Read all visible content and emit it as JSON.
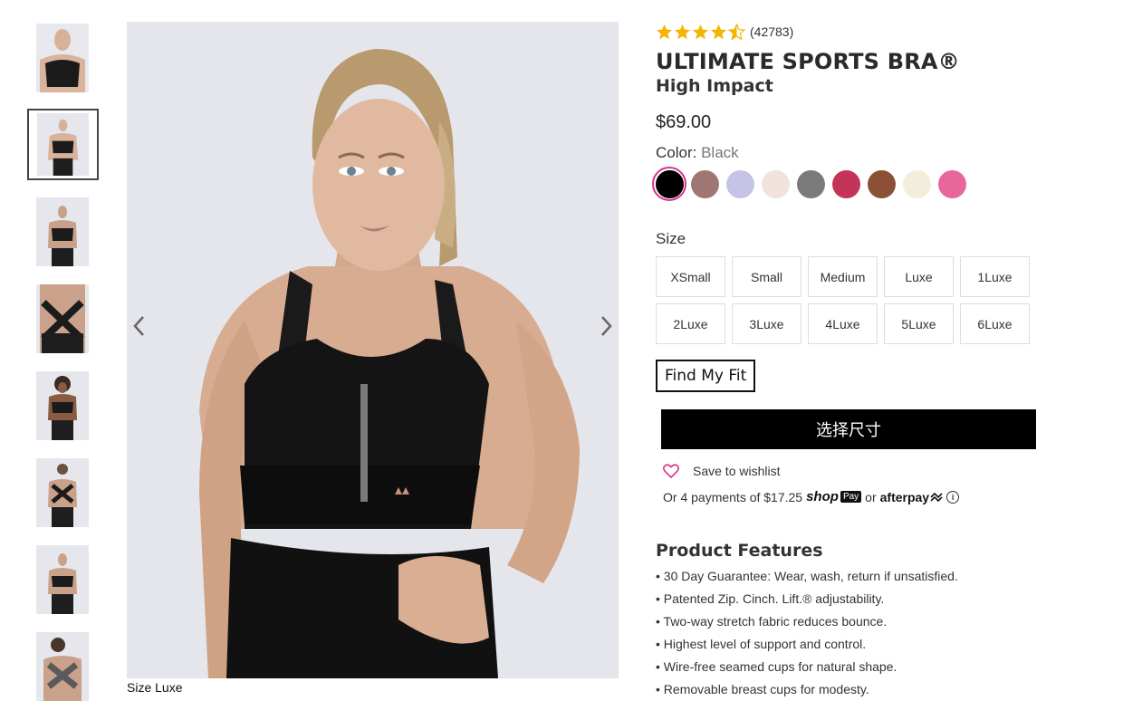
{
  "gallery": {
    "thumbnail_count": 8,
    "active_index": 1,
    "caption": "Size Luxe"
  },
  "product": {
    "rating": 4.5,
    "review_count": "(42783)",
    "title": "ULTIMATE SPORTS BRA®",
    "subtitle": "High Impact",
    "price": "$69.00",
    "color_label": "Color:",
    "color_value": "Black",
    "colors": [
      {
        "name": "Black",
        "hex": "#000000",
        "selected": true
      },
      {
        "name": "Mauve",
        "hex": "#a07674"
      },
      {
        "name": "Lavender",
        "hex": "#c5c4e6"
      },
      {
        "name": "Blush",
        "hex": "#f2e2dc"
      },
      {
        "name": "Grey",
        "hex": "#7a7a7a"
      },
      {
        "name": "Berry",
        "hex": "#c43458"
      },
      {
        "name": "Brown",
        "hex": "#8b5035"
      },
      {
        "name": "Cream",
        "hex": "#f2eedb"
      },
      {
        "name": "Pink",
        "hex": "#e8679a"
      }
    ],
    "size_label": "Size",
    "sizes": [
      "XSmall",
      "Small",
      "Medium",
      "Luxe",
      "1Luxe",
      "2Luxe",
      "3Luxe",
      "4Luxe",
      "5Luxe",
      "6Luxe"
    ],
    "find_fit_label": "Find My Fit",
    "select_size_label": "选择尺寸",
    "wishlist_label": "Save to wishlist",
    "payments": {
      "prefix": "Or 4 payments of $17.25",
      "shop": "shop",
      "pay": "Pay",
      "or": "or",
      "afterpay": "afterpay",
      "info": "i"
    },
    "features_title": "Product Features",
    "features": [
      "• 30 Day Guarantee: Wear, wash, return if unsatisfied.",
      "• Patented Zip. Cinch. Lift.® adjustability.",
      "• Two-way stretch fabric reduces bounce.",
      "• Highest level of support and control.",
      "• Wire-free seamed cups for natural shape.",
      "• Removable breast cups for modesty."
    ]
  },
  "colors": {
    "star": "#f5b400",
    "accent": "#d6338e",
    "cta_bg": "#000000"
  },
  "icons": {
    "prev": "chevron-left-icon",
    "next": "chevron-right-icon",
    "wishlist": "heart-icon",
    "star": "star-icon"
  }
}
